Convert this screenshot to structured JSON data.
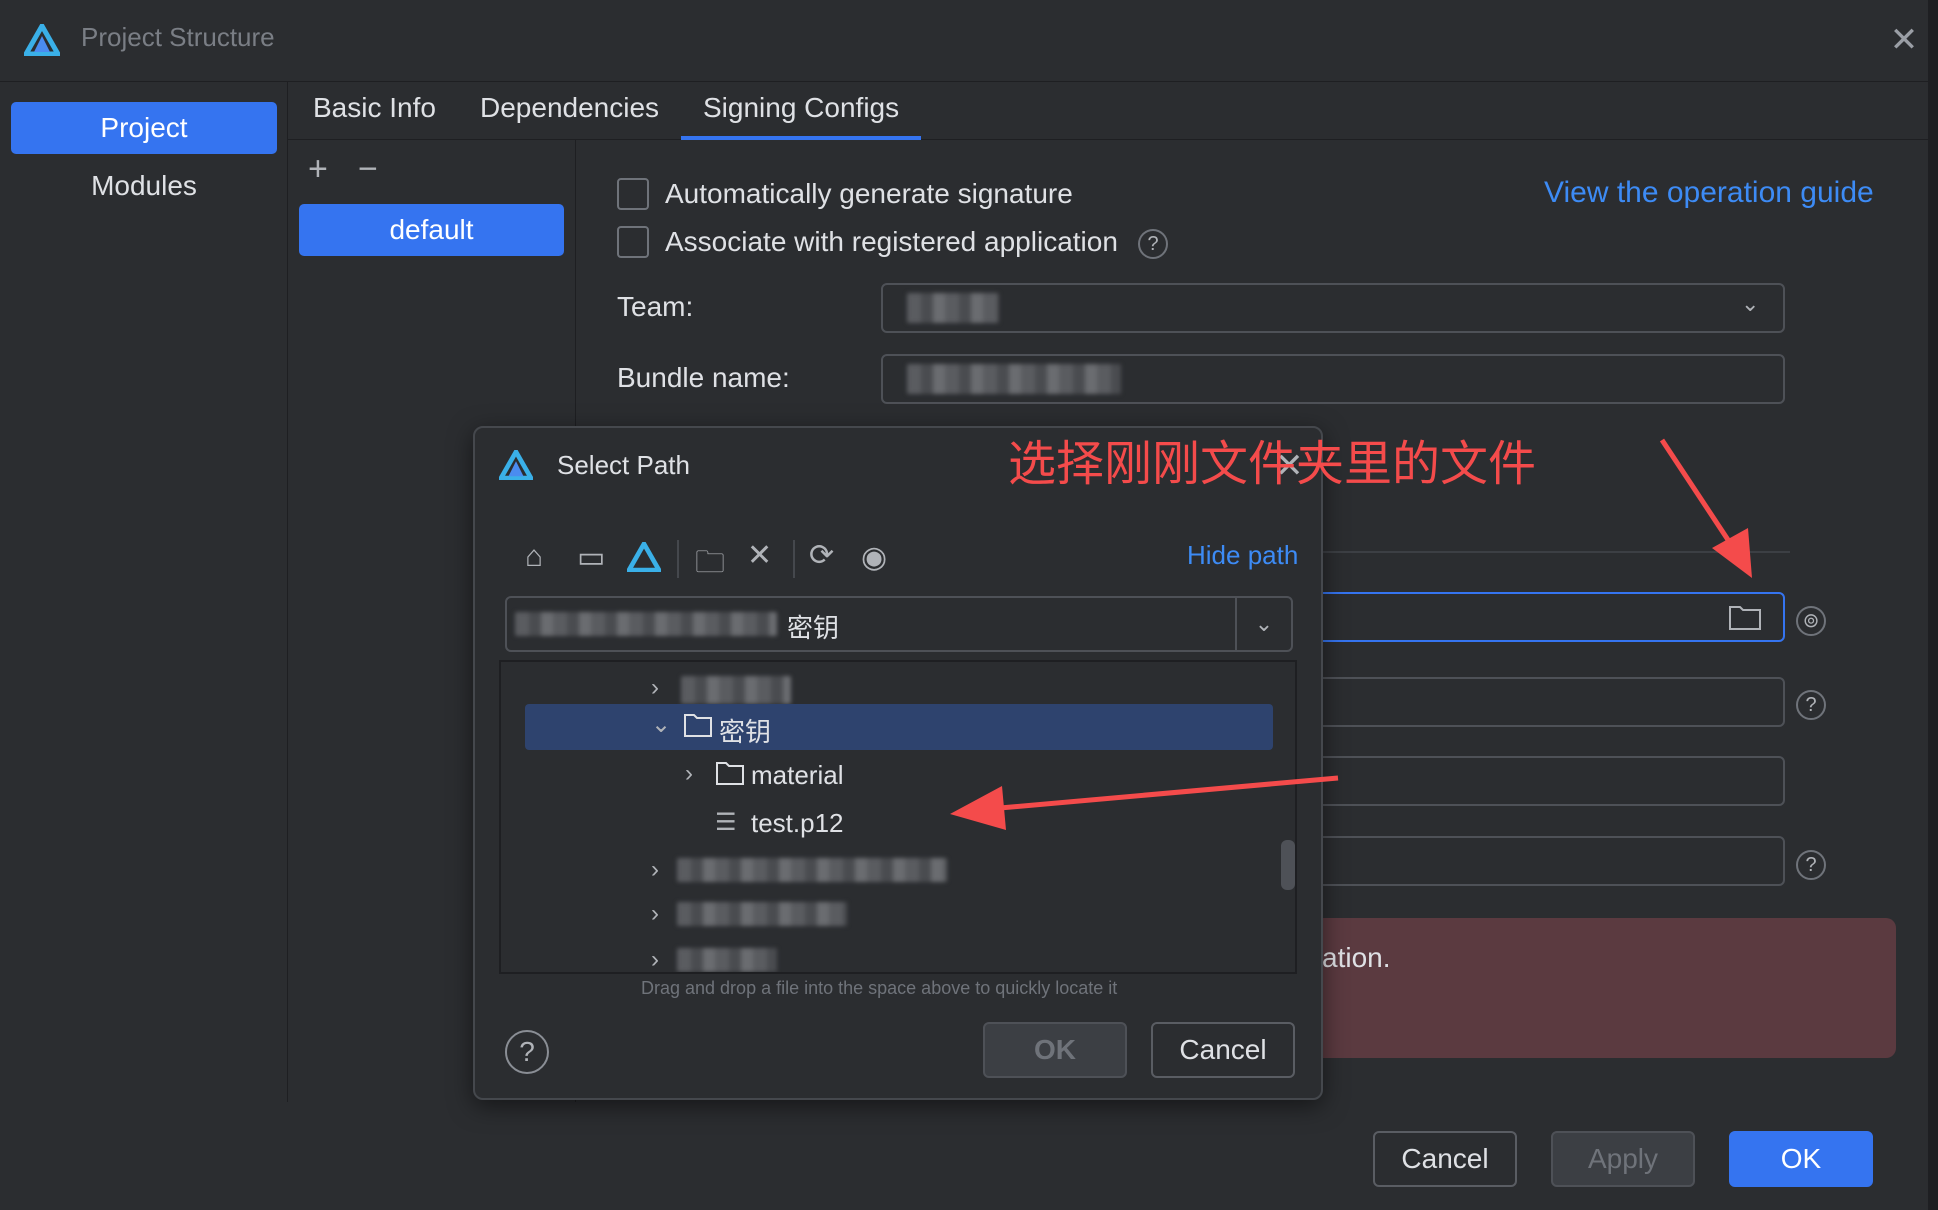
{
  "window": {
    "title": "Project Structure",
    "logo_icon": "deveco-logo-icon",
    "close_icon": "close-icon"
  },
  "nav": {
    "items": [
      {
        "label": "Project",
        "active": true
      },
      {
        "label": "Modules",
        "active": false
      }
    ]
  },
  "tabs": [
    {
      "label": "Basic Info"
    },
    {
      "label": "Dependencies"
    },
    {
      "label": "Signing Configs",
      "active": true
    }
  ],
  "configs": {
    "add_icon": "plus-icon",
    "remove_icon": "minus-icon",
    "items": [
      {
        "label": "default"
      }
    ]
  },
  "signing": {
    "auto_sign_label": "Automatically generate signature",
    "assoc_label": "Associate with registered application",
    "guide_link": "View the operation guide",
    "team_label": "Team:",
    "bundle_label": "Bundle name:",
    "error_text": "ation."
  },
  "footer": {
    "cancel": "Cancel",
    "apply": "Apply",
    "ok": "OK"
  },
  "dialog": {
    "title": "Select Path",
    "hide_path": "Hide path",
    "path_value": "密钥",
    "tree": [
      {
        "name": "密钥",
        "type": "folder",
        "expanded": true,
        "selected": true
      },
      {
        "name": "material",
        "type": "folder",
        "expanded": false
      },
      {
        "name": "test.p12",
        "type": "file"
      }
    ],
    "hint": "Drag and drop a file into the space above to quickly locate it",
    "ok": "OK",
    "cancel": "Cancel"
  },
  "annotation": {
    "text": "选择刚刚文件夹里的文件",
    "color": "#f44b4b"
  },
  "colors": {
    "accent": "#3574f0",
    "link": "#3d8bf5",
    "selection": "#2e436e",
    "error_bg": "#5b3a40"
  }
}
